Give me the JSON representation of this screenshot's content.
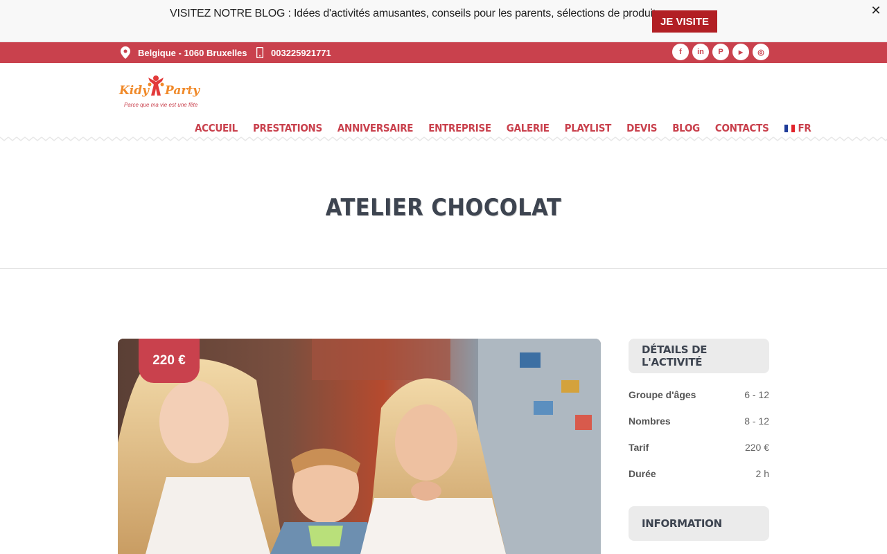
{
  "announcement": {
    "text": "VISITEZ NOTRE BLOG : Idées d'activités amusantes, conseils pour les parents, sélections de produits...",
    "button_label": "JE VISITE",
    "close_glyph": "✕"
  },
  "topbar": {
    "location": "Belgique - 1060 Bruxelles",
    "phone": "003225921771",
    "socials": [
      {
        "icon": "facebook-icon",
        "glyph": "f"
      },
      {
        "icon": "linkedin-icon",
        "glyph": "in"
      },
      {
        "icon": "pinterest-icon",
        "glyph": "P"
      },
      {
        "icon": "youtube-icon",
        "glyph": "▶"
      },
      {
        "icon": "instagram-icon",
        "glyph": "◎"
      }
    ]
  },
  "logo": {
    "word1": "Kidy",
    "word2": "Party",
    "tagline": "Parce que ma vie est une fête"
  },
  "nav": {
    "items": [
      "ACCUEIL",
      "PRESTATIONS",
      "ANNIVERSAIRE",
      "ENTREPRISE",
      "GALERIE",
      "PLAYLIST",
      "DEVIS",
      "BLOG",
      "CONTACTS"
    ],
    "language": "FR"
  },
  "page": {
    "title": "ATELIER CHOCOLAT",
    "price": "220 €"
  },
  "sidebar": {
    "details_heading": "DÉTAILS DE L'ACTIVITÉ",
    "rows": [
      {
        "label": "Groupe d'âges",
        "value": "6 - 12"
      },
      {
        "label": "Nombres",
        "value": "8 - 12"
      },
      {
        "label": "Tarif",
        "value": "220 €"
      },
      {
        "label": "Durée",
        "value": "2 h"
      }
    ],
    "info_heading": "INFORMATION"
  },
  "colors": {
    "brand_red": "#c9414d",
    "button_red": "#b21f24",
    "logo_orange": "#f08a2a",
    "heading_dark": "#3d4450"
  }
}
